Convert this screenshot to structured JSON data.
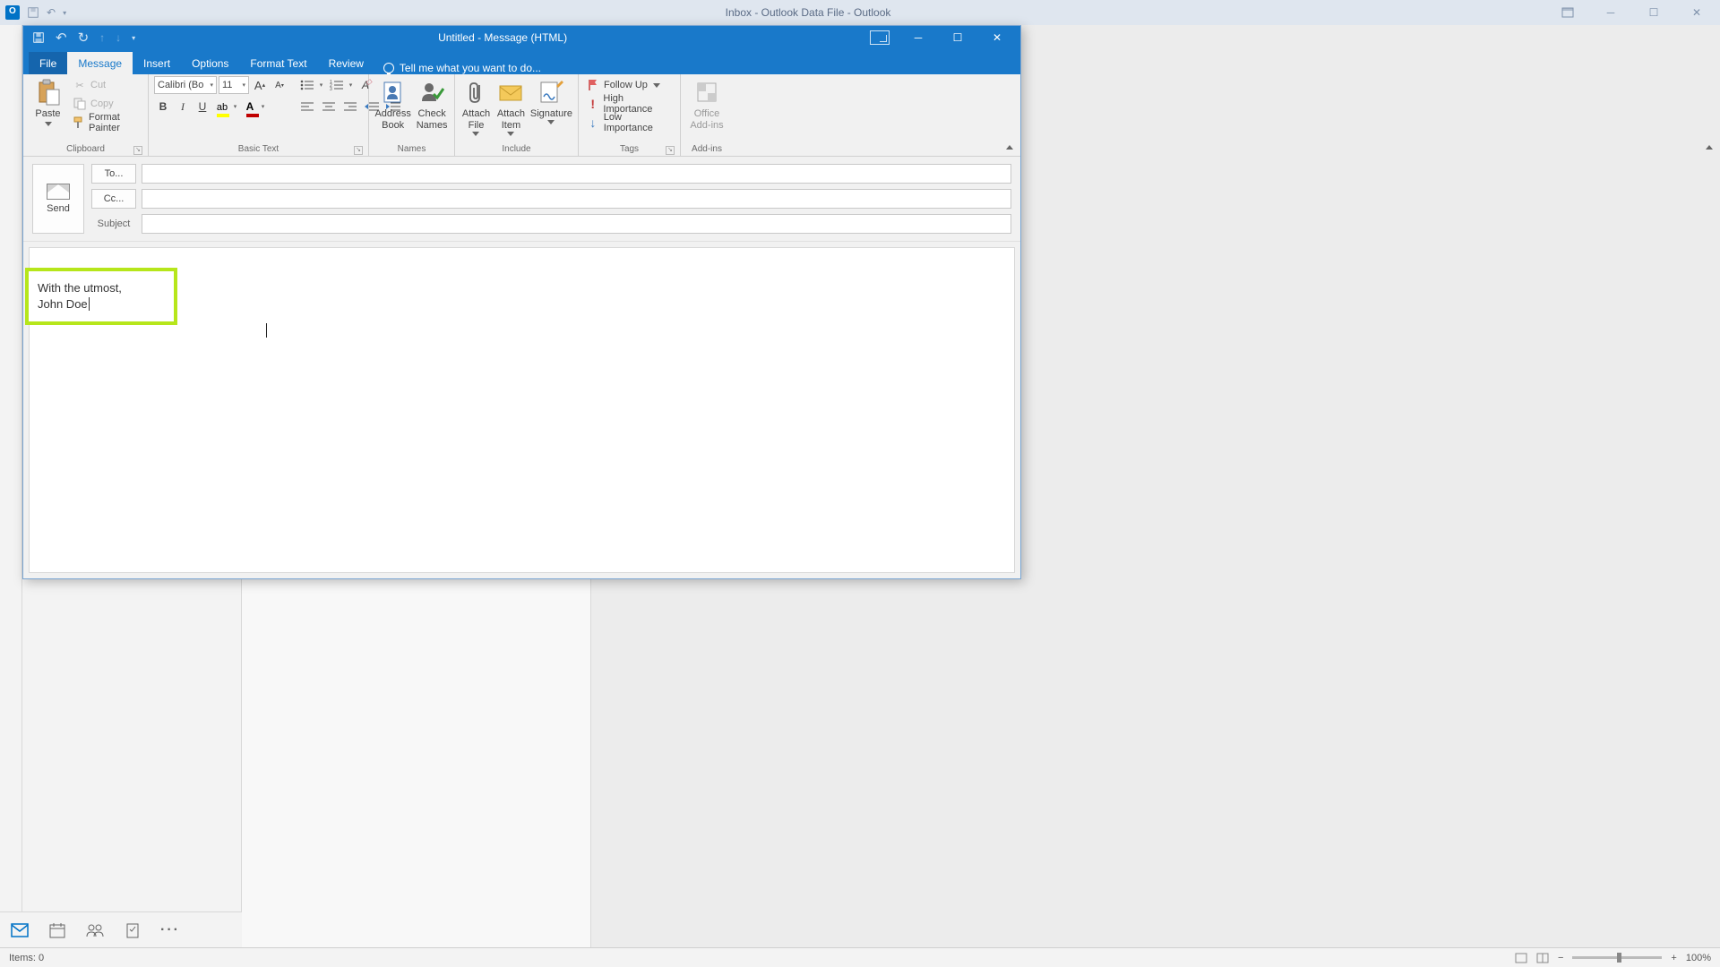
{
  "outlook_main": {
    "title": "Inbox - Outlook Data File - Outlook"
  },
  "compose": {
    "title": "Untitled - Message (HTML)",
    "tabs": {
      "file": "File",
      "message": "Message",
      "insert": "Insert",
      "options": "Options",
      "format_text": "Format Text",
      "review": "Review",
      "tell_me": "Tell me what you want to do..."
    },
    "ribbon": {
      "clipboard": {
        "paste": "Paste",
        "cut": "Cut",
        "copy": "Copy",
        "format_painter": "Format Painter",
        "group_label": "Clipboard"
      },
      "basic_text": {
        "font_name": "Calibri (Bo",
        "font_size": "11",
        "group_label": "Basic Text"
      },
      "names": {
        "address_book": "Address\nBook",
        "check_names": "Check\nNames",
        "group_label": "Names"
      },
      "include": {
        "attach_file": "Attach\nFile",
        "attach_item": "Attach\nItem",
        "signature": "Signature",
        "group_label": "Include"
      },
      "tags": {
        "follow_up": "Follow Up",
        "high_importance": "High Importance",
        "low_importance": "Low Importance",
        "group_label": "Tags"
      },
      "addins": {
        "office_addins": "Office\nAdd-ins",
        "group_label": "Add-ins"
      }
    },
    "fields": {
      "send": "Send",
      "to": "To...",
      "cc": "Cc...",
      "subject_label": "Subject",
      "to_value": "",
      "cc_value": "",
      "subject_value": ""
    },
    "body": {
      "signature_line1": "With the utmost,",
      "signature_line2": "John Doe"
    }
  },
  "statusbar": {
    "items": "Items: 0",
    "zoom": "100%"
  }
}
